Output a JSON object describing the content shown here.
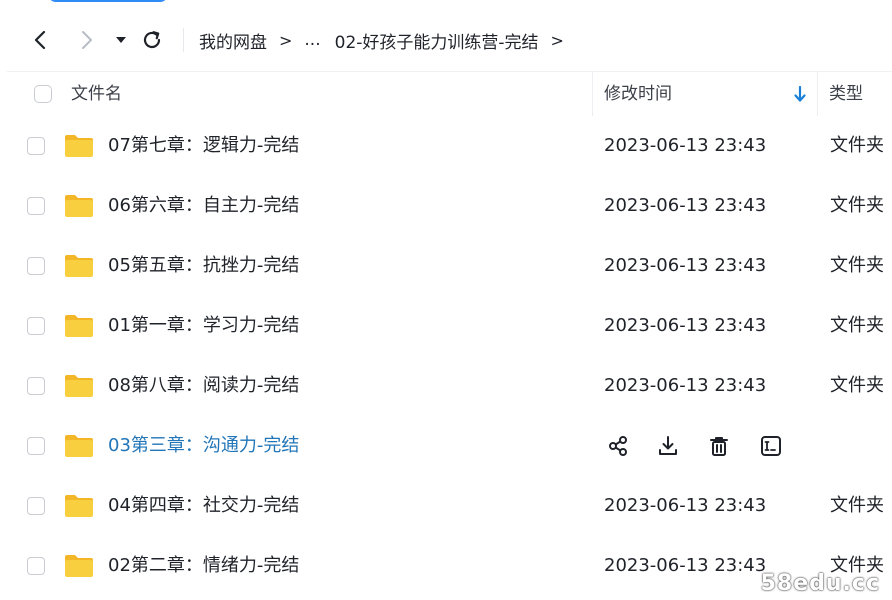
{
  "breadcrumb": {
    "root": "我的网盘",
    "sep": ">",
    "ellipsis": "...",
    "current": "02-好孩子能力训练营-完结"
  },
  "header": {
    "name": "文件名",
    "time": "修改时间",
    "type": "类型"
  },
  "rows": [
    {
      "name": "07第七章：逻辑力-完结",
      "time": "2023-06-13 23:43",
      "type": "文件夹"
    },
    {
      "name": "06第六章：自主力-完结",
      "time": "2023-06-13 23:43",
      "type": "文件夹"
    },
    {
      "name": "05第五章：抗挫力-完结",
      "time": "2023-06-13 23:43",
      "type": "文件夹"
    },
    {
      "name": "01第一章：学习力-完结",
      "time": "2023-06-13 23:43",
      "type": "文件夹"
    },
    {
      "name": "08第八章：阅读力-完结",
      "time": "2023-06-13 23:43",
      "type": "文件夹"
    },
    {
      "name": "03第三章：沟通力-完结",
      "time": "",
      "type": ""
    },
    {
      "name": "04第四章：社交力-完结",
      "time": "2023-06-13 23:43",
      "type": "文件夹"
    },
    {
      "name": "02第二章：情绪力-完结",
      "time": "2023-06-13 23:43",
      "type": "文件夹"
    }
  ],
  "watermark": "58edu.cc",
  "colors": {
    "accent": "#2f8cf7",
    "folder": "#f8cf3f",
    "hover_text": "#2276b8"
  }
}
